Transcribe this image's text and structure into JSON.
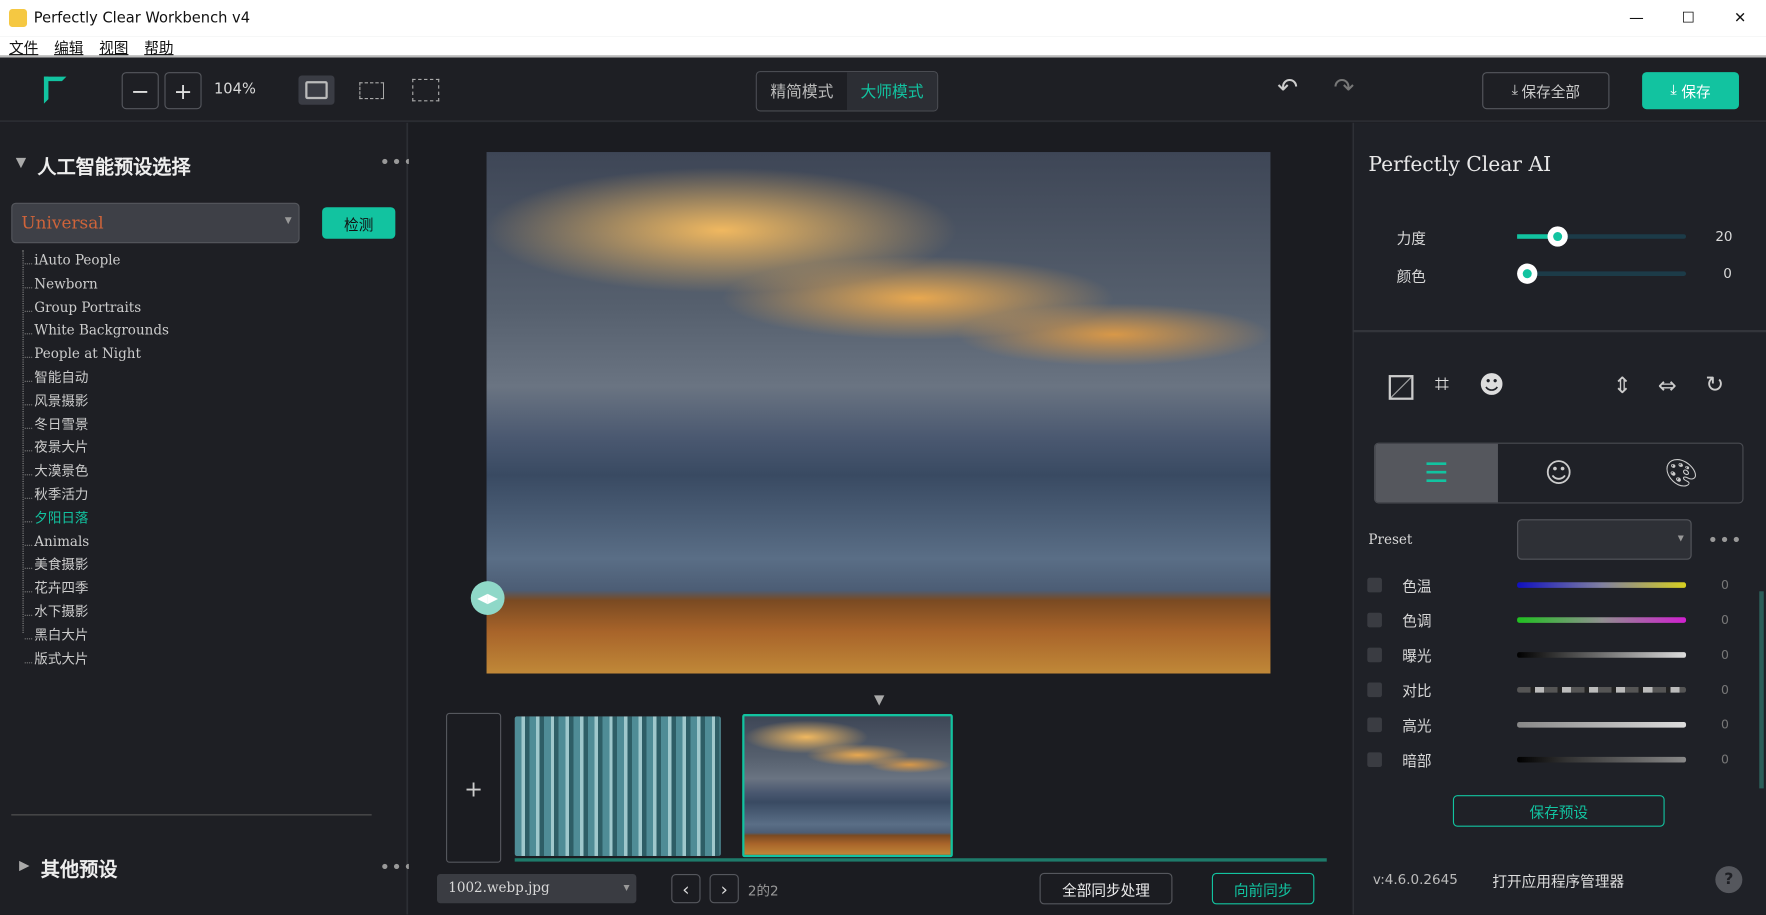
{
  "window": {
    "title": "Perfectly Clear Workbench v4"
  },
  "menu": [
    "文件",
    "编辑",
    "视图",
    "帮助"
  ],
  "toolbar": {
    "zoom_out": "−",
    "zoom_in": "+",
    "zoom_level": "104%",
    "mode_simple": "精简模式",
    "mode_master": "大师模式",
    "save_all": "保存全部",
    "save": "保存"
  },
  "left": {
    "section_title": "人工智能预设选择",
    "preset_value": "Universal",
    "detect_button": "检测",
    "presets": [
      "iAuto People",
      "Newborn",
      "Group Portraits",
      "White Backgrounds",
      "People at Night",
      "智能自动",
      "风景摄影",
      "冬日雪景",
      "夜景大片",
      "大漠景色",
      "秋季活力",
      "夕阳日落",
      "Animals",
      "美食摄影",
      "花卉四季",
      "水下摄影",
      "黑白大片",
      "版式大片"
    ],
    "selected_preset": "夕阳日落",
    "other_presets": "其他预设"
  },
  "filmstrip": {
    "add": "+",
    "file_select": "1002.webp.jpg",
    "page_info": "2的2",
    "sync_all": "全部同步处理",
    "sync_forward": "向前同步",
    "prev": "‹",
    "next": "›"
  },
  "right": {
    "title": "Perfectly Clear AI",
    "sliders": [
      {
        "label": "力度",
        "value": 20,
        "max": 100
      },
      {
        "label": "颜色",
        "value": 0,
        "max": 100
      }
    ],
    "preset_label": "Preset",
    "preset_value": "",
    "adjustments": [
      {
        "label": "色温",
        "value": "0"
      },
      {
        "label": "色调",
        "value": "0"
      },
      {
        "label": "曝光",
        "value": "0"
      },
      {
        "label": "对比",
        "value": "0"
      },
      {
        "label": "高光",
        "value": "0"
      },
      {
        "label": "暗部",
        "value": "0"
      }
    ],
    "save_preset": "保存预设",
    "version": "v:4.6.0.2645",
    "open_manager": "打开应用程序管理器",
    "help": "?"
  },
  "colors": {
    "accent": "#12c3a0",
    "preset_text": "#d0643a",
    "background": "#1e1f24"
  }
}
